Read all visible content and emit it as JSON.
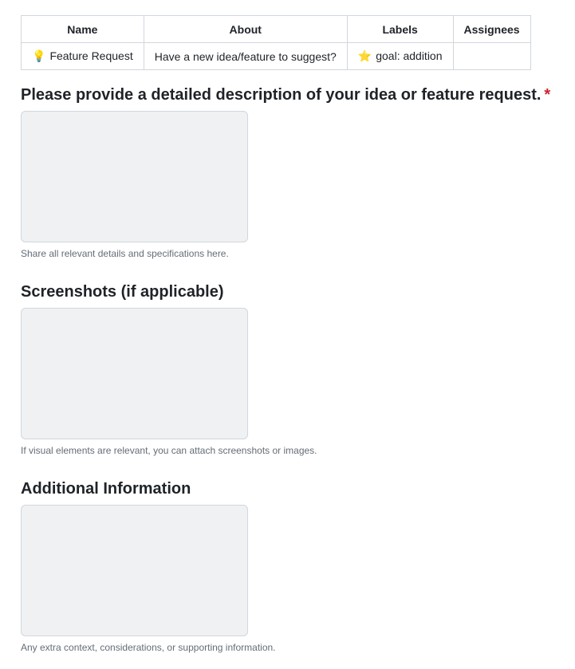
{
  "template_table": {
    "headers": [
      "Name",
      "About",
      "Labels",
      "Assignees"
    ],
    "row": {
      "name_icon": "lightbulb-icon",
      "name_emoji": "💡",
      "name": "Feature Request",
      "about": "Have a new idea/feature to suggest?",
      "labels_icon": "star-icon",
      "labels_emoji": "⭐",
      "labels": "goal: addition",
      "assignees": ""
    }
  },
  "fields": [
    {
      "label": "Please provide a detailed description of your idea or feature request.",
      "required": true,
      "required_mark": "*",
      "value": "",
      "note": "Share all relevant details and specifications here."
    },
    {
      "label": "Screenshots (if applicable)",
      "required": false,
      "value": "",
      "note": "If visual elements are relevant, you can attach screenshots or images."
    },
    {
      "label": "Additional Information",
      "required": false,
      "value": "",
      "note": "Any extra context, considerations, or supporting information."
    }
  ],
  "colors": {
    "required_mark": "#cf222e",
    "textarea_bg": "#f0f1f2",
    "border": "#d0d7de",
    "note_text": "#656d76"
  }
}
